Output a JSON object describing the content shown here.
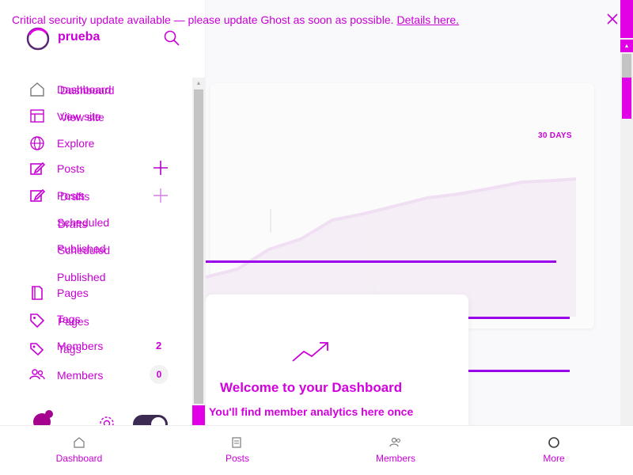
{
  "banner": {
    "message": "Critical security update available — please update Ghost as soon as possible.",
    "link": "Details here."
  },
  "site": {
    "name": "prueba"
  },
  "sidebar": {
    "nav": [
      {
        "label": "Dashboard",
        "ghost": "Dashboard"
      },
      {
        "label": "View site",
        "ghost": "View site"
      },
      {
        "label": "Explore"
      },
      {
        "label": "Posts"
      },
      {
        "label": "Posts",
        "ghost": "Drafts"
      },
      {
        "label": "Scheduled",
        "ghost": "Drafts"
      },
      {
        "label": "Published",
        "ghost": "Scheduled"
      },
      {
        "label": "Published"
      },
      {
        "label": "Pages"
      },
      {
        "label": "Tags",
        "ghost": "Pages"
      },
      {
        "label": "Members",
        "ghost": "Tags"
      },
      {
        "label": "Members"
      }
    ],
    "members_count": "2",
    "members_count_new": "0"
  },
  "dashboard": {
    "range": "30 DAYS",
    "welcome_title": "Welcome to your Dashboard",
    "welcome_text": "You'll find member analytics here once"
  },
  "bottom_nav": [
    {
      "label": "Dashboard",
      "icon": "home-icon"
    },
    {
      "label": "Posts",
      "icon": "posts-icon"
    },
    {
      "label": "Members",
      "icon": "members-icon"
    },
    {
      "label": "More",
      "icon": "more-icon"
    }
  ],
  "colors": {
    "accent": "#c800d6",
    "line": "#9a00ea",
    "scrollbar": "#e100e6"
  }
}
